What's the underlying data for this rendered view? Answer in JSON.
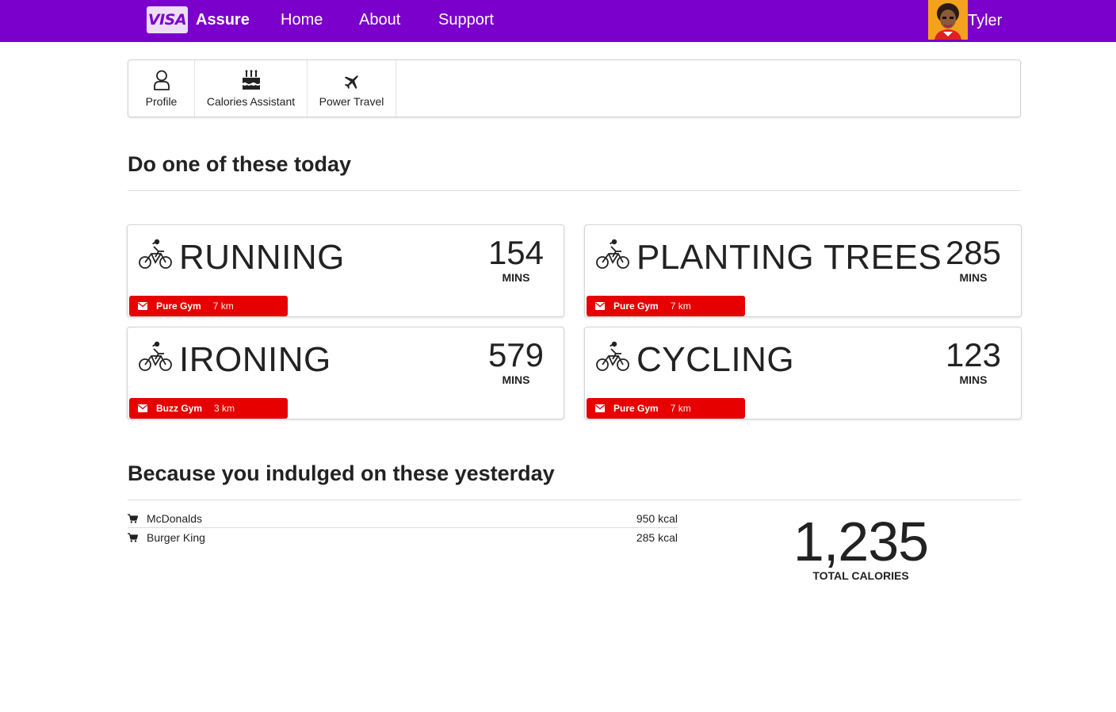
{
  "navbar": {
    "logo_text": "VISA",
    "brand": "Assure",
    "links": [
      "Home",
      "About",
      "Support"
    ],
    "user_name": "Tyler",
    "bg_color": "#7b00cc"
  },
  "submenu": {
    "items": [
      {
        "label": "Profile",
        "icon": "user-icon"
      },
      {
        "label": "Calories Assistant",
        "icon": "birthday-cake-icon"
      },
      {
        "label": "Power Travel",
        "icon": "plane-icon"
      }
    ]
  },
  "today": {
    "title": "Do one of these today",
    "activities": [
      {
        "name": "RUNNING",
        "mins": "154",
        "unit": "MINS",
        "gym": "Pure Gym",
        "distance": "7 km",
        "icon": "cyclist-icon"
      },
      {
        "name": "PLANTING TREES",
        "mins": "285",
        "unit": "MINS",
        "gym": "Pure Gym",
        "distance": "7 km",
        "icon": "cyclist-icon"
      },
      {
        "name": "IRONING",
        "mins": "579",
        "unit": "MINS",
        "gym": "Buzz Gym",
        "distance": "3 km",
        "icon": "cyclist-icon"
      },
      {
        "name": "CYCLING",
        "mins": "123",
        "unit": "MINS",
        "gym": "Pure Gym",
        "distance": "7 km",
        "icon": "cyclist-icon"
      }
    ],
    "tag_color": "#e60000"
  },
  "yesterday": {
    "title": "Because you indulged on these yesterday",
    "items": [
      {
        "name": "McDonalds",
        "kcal": "950 kcal",
        "icon": "shopping-cart-icon"
      },
      {
        "name": "Burger King",
        "kcal": "285 kcal",
        "icon": "shopping-cart-icon"
      }
    ],
    "total_value": "1,235",
    "total_label": "TOTAL CALORIES"
  }
}
